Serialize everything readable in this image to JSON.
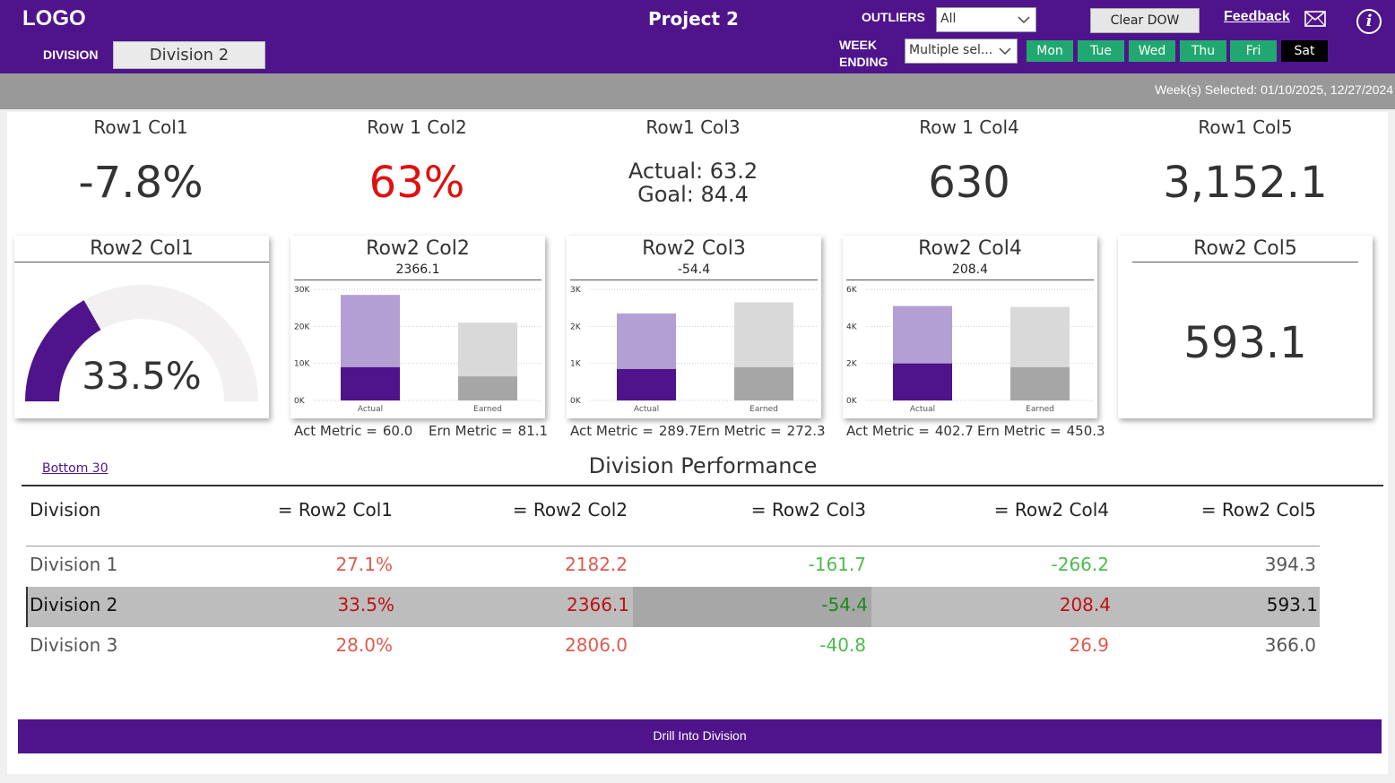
{
  "header": {
    "logo": "LOGO",
    "division_label": "DIVISION",
    "division_value": "Division 2",
    "project_title": "Project 2",
    "outliers_label": "OUTLIERS",
    "outliers_value": "All",
    "week_label_1": "WEEK",
    "week_label_2": "ENDING",
    "week_value": "Multiple sel...",
    "clear_dow": "Clear DOW",
    "feedback": "Feedback",
    "days": [
      {
        "label": "Mon",
        "selected": false
      },
      {
        "label": "Tue",
        "selected": false
      },
      {
        "label": "Wed",
        "selected": false
      },
      {
        "label": "Thu",
        "selected": false
      },
      {
        "label": "Fri",
        "selected": false
      },
      {
        "label": "Sat",
        "selected": true
      }
    ],
    "icons": {
      "mail": "mail-icon",
      "info": "info-icon",
      "chevron": "chevron-down-icon"
    }
  },
  "weeks_selected": "Week(s) Selected: 01/10/2025, 12/27/2024",
  "kpis": [
    {
      "title": "Row1 Col1",
      "value": "-7.8%",
      "color": "#333333"
    },
    {
      "title": "Row 1 Col2",
      "value": "63%",
      "color": "#e01010"
    },
    {
      "title": "Row1 Col3",
      "actual": "Actual: 63.2",
      "goal": "Goal: 84.4"
    },
    {
      "title": "Row 1 Col4",
      "value": "630",
      "color": "#333333"
    },
    {
      "title": "Row1 Col5",
      "value": "3,152.1",
      "color": "#333333"
    }
  ],
  "cards": {
    "gauge": {
      "title": "Row2 Col1",
      "value": "33.5%",
      "fraction": 0.335
    },
    "card5": {
      "title": "Row2 Col5",
      "value": "593.1"
    }
  },
  "chart_data": [
    {
      "type": "bar",
      "title": "Row2 Col2",
      "subtitle": "2366.1",
      "categories": [
        "Actual",
        "Earned"
      ],
      "ylim": [
        0,
        30000
      ],
      "yticks": [
        {
          "v": 0,
          "label": "0K"
        },
        {
          "v": 10000,
          "label": "10K"
        },
        {
          "v": 20000,
          "label": "20K"
        },
        {
          "v": 30000,
          "label": "30K"
        }
      ],
      "series": [
        {
          "values": [
            9000,
            6500
          ]
        },
        {
          "values": [
            28500,
            21000
          ]
        }
      ],
      "act_label": "Act Metric =",
      "act_value": "60.0",
      "ern_label": "Ern Metric =",
      "ern_value": "81.1"
    },
    {
      "type": "bar",
      "title": "Row2 Col3",
      "subtitle": "-54.4",
      "categories": [
        "Actual",
        "Earned"
      ],
      "ylim": [
        0,
        3000
      ],
      "yticks": [
        {
          "v": 0,
          "label": "0K"
        },
        {
          "v": 1000,
          "label": "1K"
        },
        {
          "v": 2000,
          "label": "2K"
        },
        {
          "v": 3000,
          "label": "3K"
        }
      ],
      "series": [
        {
          "values": [
            850,
            900
          ]
        },
        {
          "values": [
            2350,
            2650
          ]
        }
      ],
      "act_label": "Act Metric =",
      "act_value": "289.7",
      "ern_label": "Ern Metric =",
      "ern_value": "272.3"
    },
    {
      "type": "bar",
      "title": "Row2 Col4",
      "subtitle": "208.4",
      "categories": [
        "Actual",
        "Earned"
      ],
      "ylim": [
        0,
        6000
      ],
      "yticks": [
        {
          "v": 0,
          "label": "0K"
        },
        {
          "v": 2000,
          "label": "2K"
        },
        {
          "v": 4000,
          "label": "4K"
        },
        {
          "v": 6000,
          "label": "6K"
        }
      ],
      "series": [
        {
          "values": [
            2000,
            1800
          ]
        },
        {
          "values": [
            5100,
            5050
          ]
        }
      ],
      "act_label": "Act Metric =",
      "act_value": "402.7",
      "ern_label": "Ern Metric =",
      "ern_value": "450.3"
    }
  ],
  "colors": {
    "brand": "#4f148c",
    "actual_dark": "#4f148c",
    "actual_light": "#b39fd3",
    "earned_dark": "#a6a6a6",
    "earned_light": "#d9d9d9",
    "day_green": "#21a871",
    "day_selected": "#000000",
    "red": "#e05a50",
    "green": "#4cbb4c"
  },
  "perf": {
    "link": "Bottom 30",
    "title": "Division Performance",
    "headers": [
      "Division",
      "= Row2 Col1",
      "= Row2 Col2",
      "= Row2 Col3",
      "= Row2 Col4",
      "= Row2 Col5"
    ],
    "rows": [
      {
        "cells": [
          "Division 1",
          "27.1%",
          "2182.2",
          "-161.7",
          "-266.2",
          "394.3"
        ],
        "tones": [
          "name",
          "red",
          "red",
          "green",
          "green",
          "gray"
        ],
        "selected": false
      },
      {
        "cells": [
          "Division 2",
          "33.5%",
          "2366.1",
          "-54.4",
          "208.4",
          "593.1"
        ],
        "tones": [
          "name",
          "red",
          "red",
          "green",
          "red",
          "gray"
        ],
        "selected": true
      },
      {
        "cells": [
          "Division 3",
          "28.0%",
          "2806.0",
          "-40.8",
          "26.9",
          "366.0"
        ],
        "tones": [
          "name",
          "red",
          "red",
          "green",
          "red",
          "gray"
        ],
        "selected": false
      }
    ]
  },
  "drill_button": "Drill Into Division"
}
